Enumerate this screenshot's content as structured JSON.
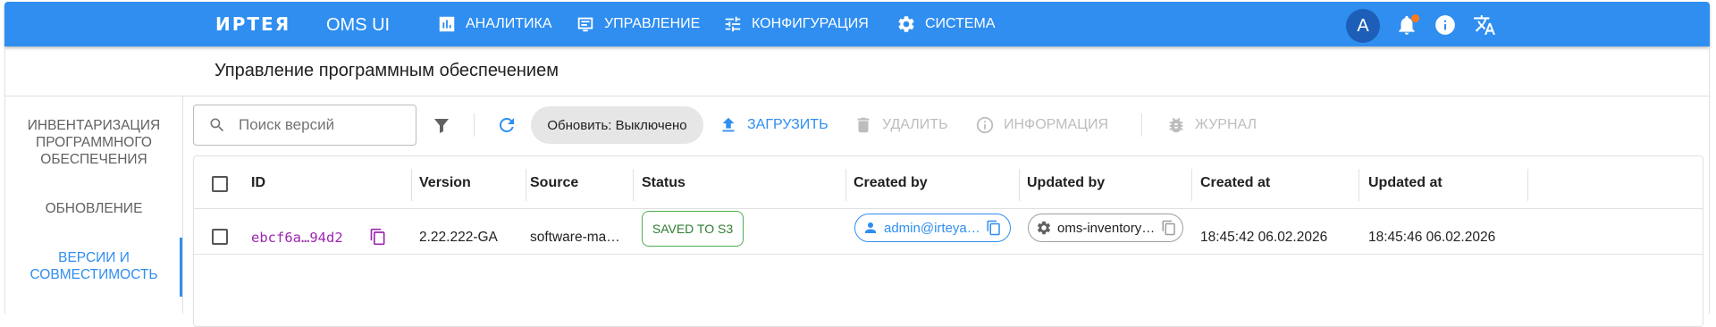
{
  "header": {
    "brand": "ИРТЕЯ",
    "product": "OMS UI",
    "nav": [
      {
        "label": "Аналитика",
        "icon": "analytics-icon"
      },
      {
        "label": "Управление",
        "icon": "dashboard-icon"
      },
      {
        "label": "Конфигурация",
        "icon": "tune-icon"
      },
      {
        "label": "Система",
        "icon": "gear-icon"
      }
    ],
    "avatar_letter": "A",
    "notification_badge_color": "#ff7a1a",
    "accent_color": "#2f8ef0"
  },
  "page": {
    "title": "Управление программным обеспечением"
  },
  "sidebar": {
    "items": [
      {
        "label": "Инвентаризация программного обеспечения",
        "active": false
      },
      {
        "label": "Обновление",
        "active": false
      },
      {
        "label": "Версии и совместимость",
        "active": true
      }
    ]
  },
  "toolbar": {
    "search_placeholder": "Поиск версий",
    "refresh_chip": "Обновить: Выключено",
    "upload": "Загрузить",
    "delete": "Удалить",
    "info": "Информация",
    "log": "Журнал"
  },
  "table": {
    "columns": [
      "ID",
      "Version",
      "Source",
      "Status",
      "Created by",
      "Updated by",
      "Created at",
      "Updated at"
    ],
    "rows": [
      {
        "id": "ebcf6a…94d2",
        "version": "2.22.222-GA",
        "source": "software-ma…",
        "status": "SAVED TO S3",
        "created_by": "admin@irteya…",
        "updated_by": "oms-inventory…",
        "created_at": "18:45:42 06.02.2026",
        "updated_at": "18:45:46 06.02.2026"
      }
    ]
  }
}
